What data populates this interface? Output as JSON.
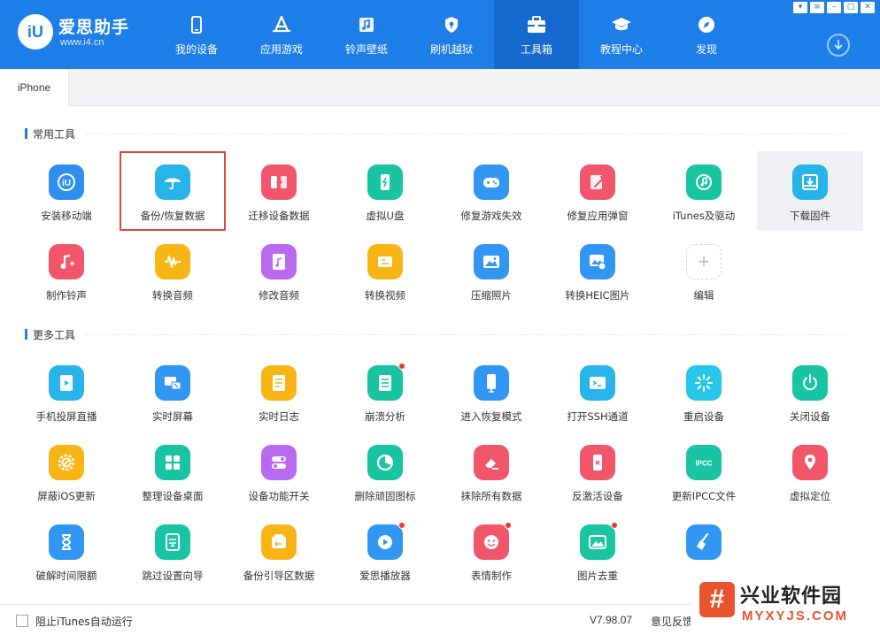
{
  "app": {
    "brand_name": "爱思助手",
    "brand_url": "www.i4.cn",
    "logo_mark": "iU",
    "colors": {
      "brand_blue": "#1e7ee8",
      "active_nav": "#1669cf",
      "highlight_red": "#e0473a"
    }
  },
  "nav": {
    "items": [
      {
        "label": "我的设备",
        "icon": "phone-icon"
      },
      {
        "label": "应用游戏",
        "icon": "app-store-icon"
      },
      {
        "label": "铃声壁纸",
        "icon": "music-note-icon"
      },
      {
        "label": "刷机越狱",
        "icon": "shield-key-icon"
      },
      {
        "label": "工具箱",
        "icon": "toolbox-icon",
        "active": true
      },
      {
        "label": "教程中心",
        "icon": "graduation-cap-icon"
      },
      {
        "label": "发现",
        "icon": "compass-icon"
      }
    ]
  },
  "window": {
    "controls": [
      "shirt-icon",
      "settings-icon",
      "minimize-icon",
      "maximize-icon",
      "close-icon"
    ]
  },
  "tabs": [
    {
      "label": "iPhone",
      "active": true
    }
  ],
  "sections": {
    "common": {
      "title": "常用工具",
      "tools": [
        {
          "label": "安装移动端",
          "icon": "i4-mobile-icon",
          "color": "#2f8ef0"
        },
        {
          "label": "备份/恢复数据",
          "icon": "umbrella-icon",
          "color": "#26b4ea",
          "selected": true
        },
        {
          "label": "迁移设备数据",
          "icon": "transfer-icon",
          "color": "#f2566b"
        },
        {
          "label": "虚拟U盘",
          "icon": "usb-drive-icon",
          "color": "#18c4a1"
        },
        {
          "label": "修复游戏失效",
          "icon": "gamepad-icon",
          "color": "#3296f3"
        },
        {
          "label": "修复应用弹窗",
          "icon": "wrench-icon",
          "color": "#f2566b"
        },
        {
          "label": "iTunes及驱动",
          "icon": "itunes-icon",
          "color": "#18c4a1"
        },
        {
          "label": "下载固件",
          "icon": "download-box-icon",
          "color": "#26b4ea",
          "hover": true
        },
        {
          "label": "制作铃声",
          "icon": "bell-music-icon",
          "color": "#f2566b"
        },
        {
          "label": "转换音频",
          "icon": "waveform-icon",
          "color": "#f8b616"
        },
        {
          "label": "修改音频",
          "icon": "audio-file-icon",
          "color": "#b96af0"
        },
        {
          "label": "转换视频",
          "icon": "video-icon",
          "color": "#f8b616"
        },
        {
          "label": "压缩照片",
          "icon": "image-icon",
          "color": "#3296f3"
        },
        {
          "label": "转换HEIC图片",
          "icon": "heic-image-icon",
          "color": "#3296f3"
        },
        {
          "label": "编辑",
          "icon": "plus-icon",
          "add": true
        }
      ]
    },
    "more": {
      "title": "更多工具",
      "tools": [
        {
          "label": "手机投屏直播",
          "icon": "screen-cast-icon",
          "color": "#26b4ea"
        },
        {
          "label": "实时屏幕",
          "icon": "live-screen-icon",
          "color": "#3296f3"
        },
        {
          "label": "实时日志",
          "icon": "log-icon",
          "color": "#f8b616"
        },
        {
          "label": "崩溃分析",
          "icon": "crash-report-icon",
          "color": "#18c4a1",
          "dot": true
        },
        {
          "label": "进入恢复模式",
          "icon": "recovery-phone-icon",
          "color": "#3296f3"
        },
        {
          "label": "打开SSH通道",
          "icon": "terminal-icon",
          "color": "#26b4ea"
        },
        {
          "label": "重启设备",
          "icon": "restart-icon",
          "color": "#26c6e8"
        },
        {
          "label": "关闭设备",
          "icon": "power-icon",
          "color": "#18c4a1"
        },
        {
          "label": "屏蔽iOS更新",
          "icon": "gear-block-icon",
          "color": "#f8b616"
        },
        {
          "label": "整理设备桌面",
          "icon": "grid-icon",
          "color": "#18c4a1"
        },
        {
          "label": "设备功能开关",
          "icon": "toggle-icon",
          "color": "#b96af0"
        },
        {
          "label": "删除顽固图标",
          "icon": "pie-icon",
          "color": "#18c4a1"
        },
        {
          "label": "抹除所有数据",
          "icon": "eraser-icon",
          "color": "#f2566b"
        },
        {
          "label": "反激活设备",
          "icon": "deactivate-icon",
          "color": "#f2566b"
        },
        {
          "label": "更新IPCC文件",
          "icon": "ipcc-icon",
          "color": "#18c4a1"
        },
        {
          "label": "虚拟定位",
          "icon": "location-pin-icon",
          "color": "#f2566b"
        },
        {
          "label": "破解时间限额",
          "icon": "hourglass-icon",
          "color": "#3296f3"
        },
        {
          "label": "跳过设置向导",
          "icon": "skip-guide-icon",
          "color": "#18c4a1"
        },
        {
          "label": "备份引导区数据",
          "icon": "boot-backup-icon",
          "color": "#f8b616"
        },
        {
          "label": "爱思播放器",
          "icon": "play-icon",
          "color": "#3296f3",
          "dot": true
        },
        {
          "label": "表情制作",
          "icon": "emoji-icon",
          "color": "#f2566b",
          "dot": true
        },
        {
          "label": "图片去重",
          "icon": "photo-dedupe-icon",
          "color": "#18c4a1",
          "dot": true
        },
        {
          "label": "",
          "icon": "broom-icon",
          "color": "#3296f3"
        }
      ]
    }
  },
  "footer": {
    "auto_run_label": "阻止iTunes自动运行",
    "version": "V7.98.07",
    "feedback": "意见反馈"
  },
  "watermark": {
    "mark": "#",
    "cn": "兴业软件园",
    "en": "MYXYJS.COM"
  }
}
